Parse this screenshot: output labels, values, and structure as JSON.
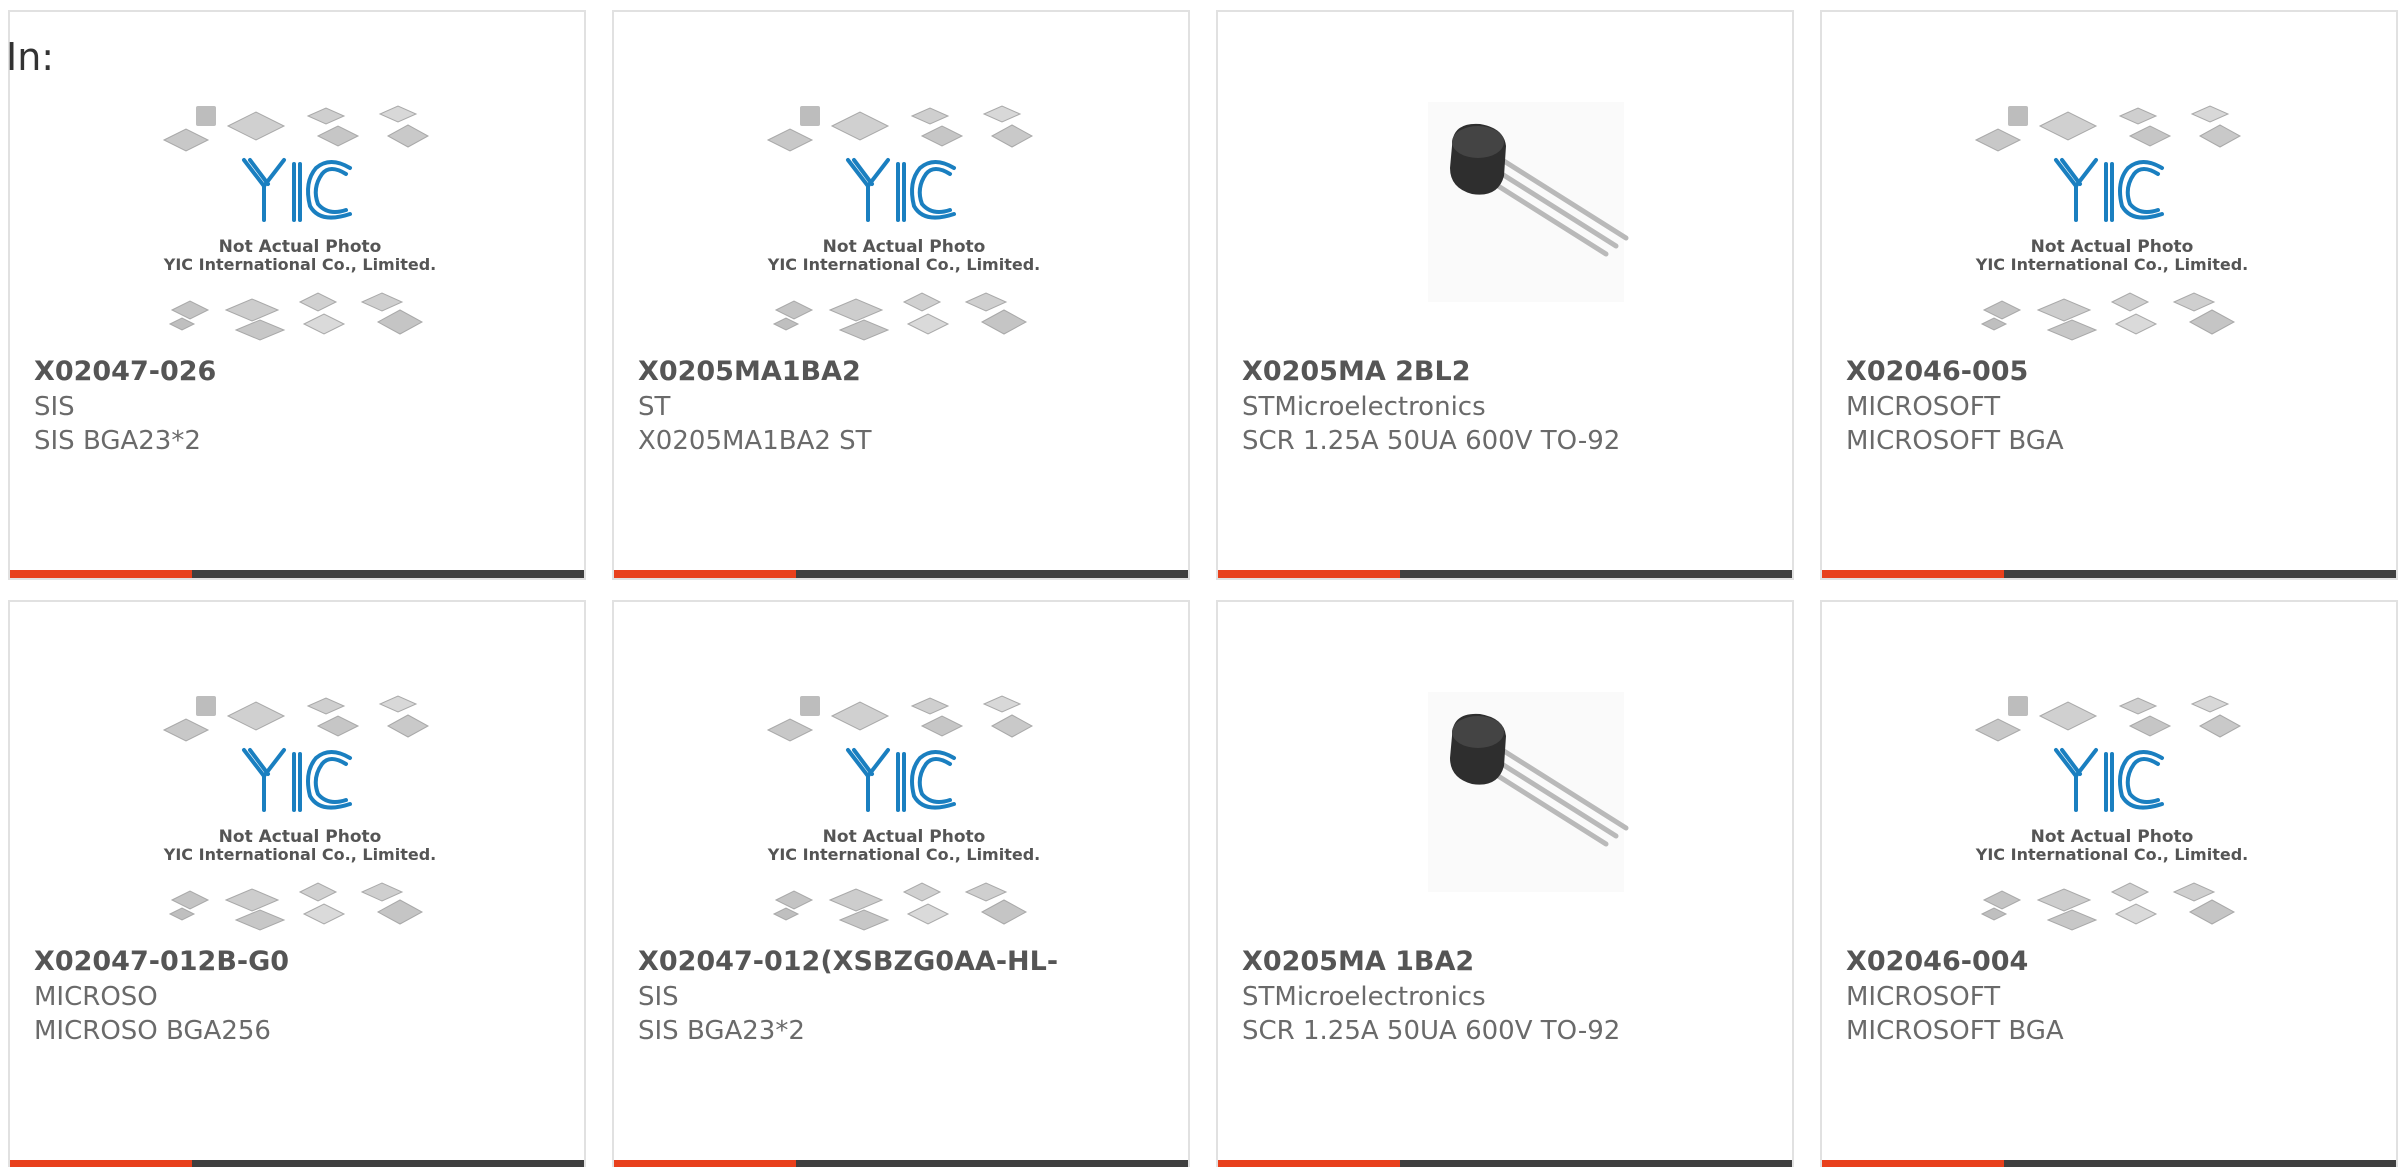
{
  "header": {
    "label": "In:"
  },
  "colors": {
    "accent": "#e8401c",
    "bar": "#3f3f3f",
    "yic_blue": "#1a7fc0"
  },
  "placeholder": {
    "icon": "yic-placeholder-icon",
    "brand": "YIC",
    "line1": "Not Actual Photo",
    "line2": "YIC International Co., Limited."
  },
  "products": [
    {
      "part_number": "X02047-026",
      "manufacturer": "SIS",
      "description": "SIS BGA23*2",
      "image": "yic-placeholder-icon"
    },
    {
      "part_number": "X0205MA1BA2",
      "manufacturer": "ST",
      "description": "X0205MA1BA2 ST",
      "image": "yic-placeholder-icon"
    },
    {
      "part_number": "X0205MA 2BL2",
      "manufacturer": "STMicroelectronics",
      "description": "SCR 1.25A 50UA 600V TO-92",
      "image": "to92-transistor-icon"
    },
    {
      "part_number": "X02046-005",
      "manufacturer": "MICROSOFT",
      "description": "MICROSOFT BGA",
      "image": "yic-placeholder-icon"
    },
    {
      "part_number": "X02047-012B-G0",
      "manufacturer": "MICROSO",
      "description": "MICROSO BGA256",
      "image": "yic-placeholder-icon"
    },
    {
      "part_number": "X02047-012(XSBZG0AA-HL-",
      "manufacturer": "SIS",
      "description": "SIS BGA23*2",
      "image": "yic-placeholder-icon"
    },
    {
      "part_number": "X0205MA 1BA2",
      "manufacturer": "STMicroelectronics",
      "description": "SCR 1.25A 50UA 600V TO-92",
      "image": "to92-transistor-icon"
    },
    {
      "part_number": "X02046-004",
      "manufacturer": "MICROSOFT",
      "description": "MICROSOFT BGA",
      "image": "yic-placeholder-icon"
    }
  ]
}
